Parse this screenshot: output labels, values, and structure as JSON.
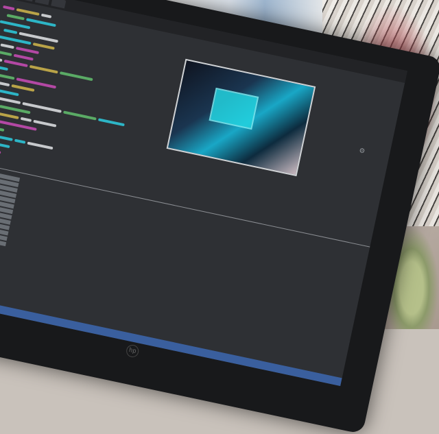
{
  "scene": {
    "description_text": "",
    "monitor_brand_mark": "hp"
  },
  "editor": {
    "tabs": [
      "",
      "",
      "",
      ""
    ],
    "code_lines": 40,
    "status_color": "#3a5f9e"
  },
  "colors": {
    "cyan": "#2ec4d6",
    "magenta": "#c24bb0",
    "yellow": "#c9b04a",
    "green": "#5fb86a",
    "white": "#d8dadd"
  }
}
